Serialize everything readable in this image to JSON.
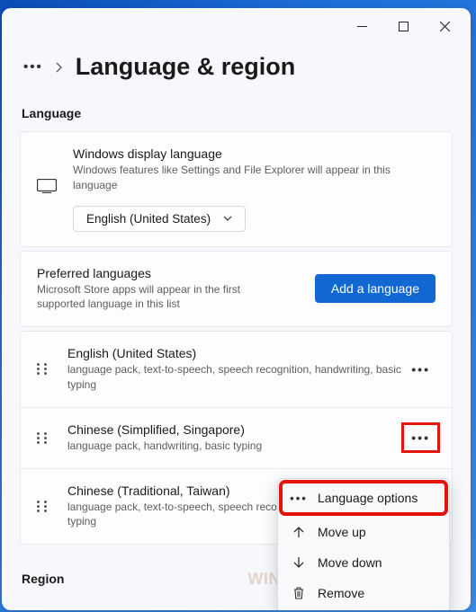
{
  "page": {
    "title": "Language & region"
  },
  "sections": {
    "language_label": "Language",
    "region_label": "Region"
  },
  "display_language": {
    "title": "Windows display language",
    "description": "Windows features like Settings and File Explorer will appear in this language",
    "selected": "English (United States)"
  },
  "preferred": {
    "title": "Preferred languages",
    "description": "Microsoft Store apps will appear in the first supported language in this list",
    "add_button": "Add a language"
  },
  "languages": [
    {
      "name": "English (United States)",
      "features": "language pack, text-to-speech, speech recognition, handwriting, basic typing"
    },
    {
      "name": "Chinese (Simplified, Singapore)",
      "features": "language pack, handwriting, basic typing"
    },
    {
      "name": "Chinese (Traditional, Taiwan)",
      "features": "language pack, text-to-speech, speech recognition, handwriting, basic typing"
    }
  ],
  "context_menu": {
    "options": "Language options",
    "move_up": "Move up",
    "move_down": "Move down",
    "remove": "Remove"
  },
  "watermark": "WINDOWSDIGITAL.COM"
}
